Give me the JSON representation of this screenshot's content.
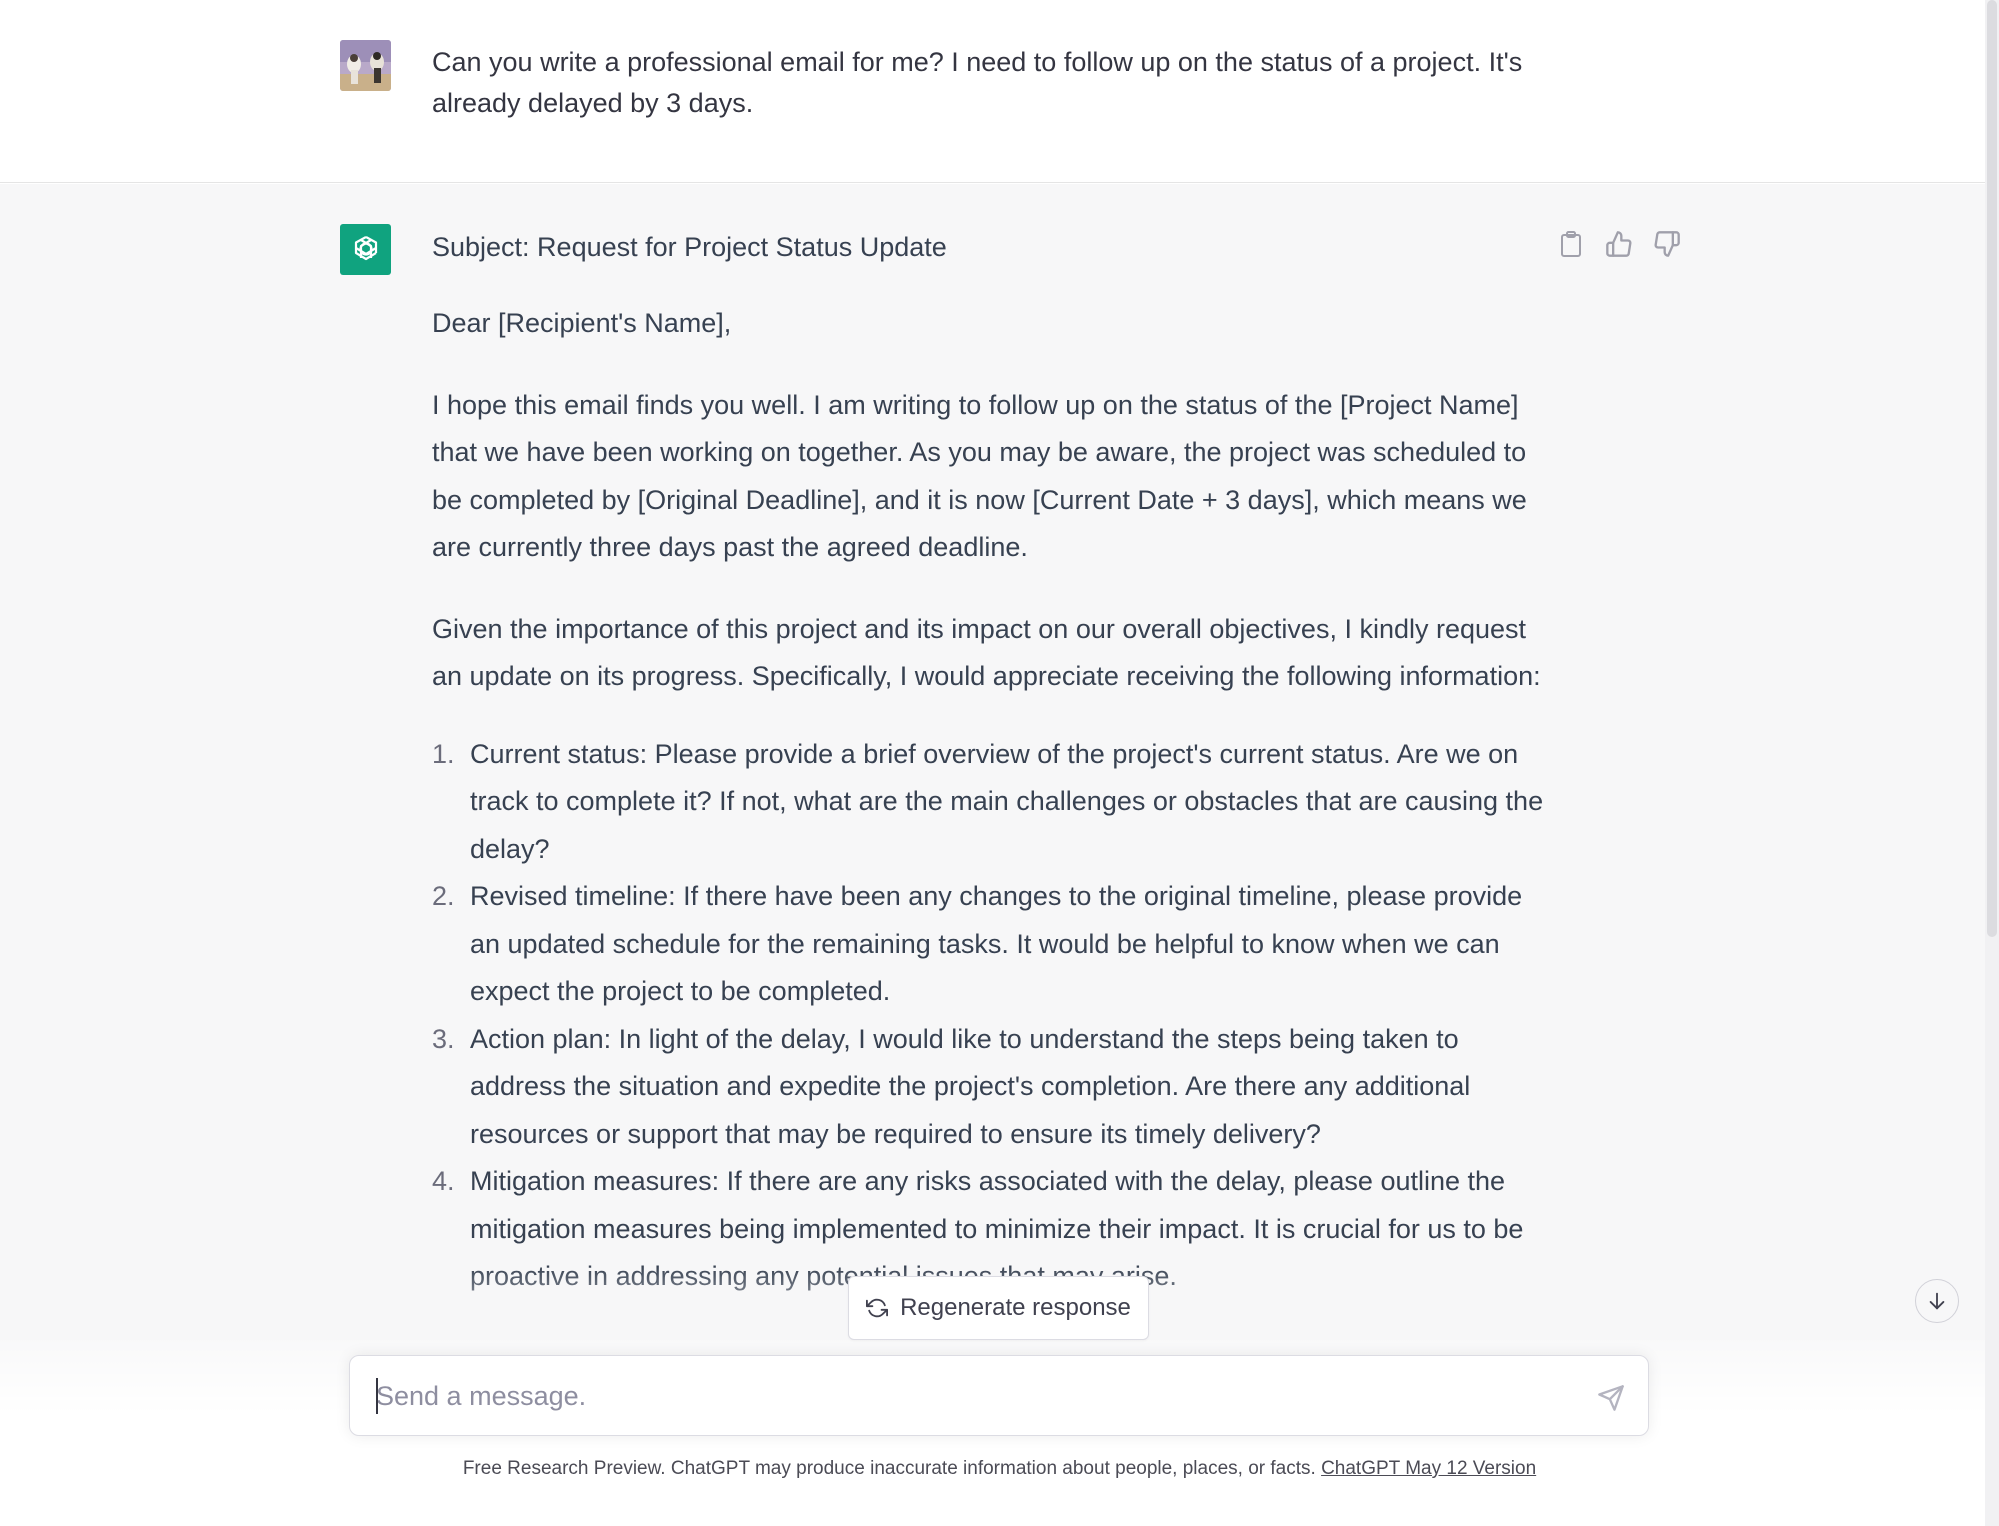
{
  "user_message": {
    "text": "Can you write a professional email for me? I need to follow up on the status of a project. It's already delayed by 3 days."
  },
  "assistant_message": {
    "subject": "Subject: Request for Project Status Update",
    "greeting": "Dear [Recipient's Name],",
    "paragraph_1": "I hope this email finds you well. I am writing to follow up on the status of the [Project Name] that we have been working on together. As you may be aware, the project was scheduled to be completed by [Original Deadline], and it is now [Current Date + 3 days], which means we are currently three days past the agreed deadline.",
    "paragraph_2": "Given the importance of this project and its impact on our overall objectives, I kindly request an update on its progress. Specifically, I would appreciate receiving the following information:",
    "list": [
      {
        "num": "1.",
        "text": "Current status: Please provide a brief overview of the project's current status. Are we on track to complete it? If not, what are the main challenges or obstacles that are causing the delay?"
      },
      {
        "num": "2.",
        "text": "Revised timeline: If there have been any changes to the original timeline, please provide an updated schedule for the remaining tasks. It would be helpful to know when we can expect the project to be completed."
      },
      {
        "num": "3.",
        "text": "Action plan: In light of the delay, I would like to understand the steps being taken to address the situation and expedite the project's completion. Are there any additional resources or support that may be required to ensure its timely delivery?"
      },
      {
        "num": "4.",
        "text": "Mitigation measures: If there are any risks associated with the delay, please outline the mitigation measures being implemented to minimize their impact. It is crucial for us to be proactive in addressing any potential issues that may arise."
      }
    ]
  },
  "actions": {
    "regenerate_label": "Regenerate response"
  },
  "composer": {
    "placeholder": "Send a message."
  },
  "footer": {
    "text": "Free Research Preview. ChatGPT may produce inaccurate information about people, places, or facts. ",
    "link": "ChatGPT May 12 Version"
  },
  "colors": {
    "brand": "#10a37f",
    "assistant_bg": "#f7f7f8",
    "text": "#374151"
  },
  "icons": {
    "copy": "clipboard-icon",
    "like": "thumbs-up-icon",
    "dislike": "thumbs-down-icon",
    "regenerate": "refresh-icon",
    "send": "send-icon",
    "scroll": "arrow-down-icon",
    "assistant_avatar": "openai-logo-icon"
  }
}
